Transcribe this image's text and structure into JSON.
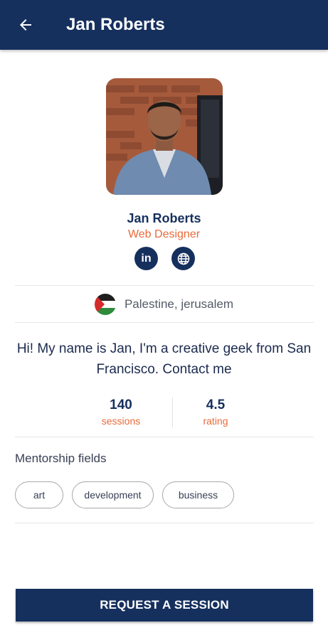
{
  "header": {
    "title": "Jan Roberts",
    "back_icon": "arrow-left-icon"
  },
  "profile": {
    "name": "Jan Roberts",
    "role": "Web Designer",
    "social": [
      {
        "icon": "linkedin-icon",
        "label": "in"
      },
      {
        "icon": "globe-icon"
      }
    ],
    "location": {
      "flag_icon": "palestine-flag-icon",
      "text": "Palestine, jerusalem"
    },
    "bio": "Hi! My name is Jan, I'm a creative geek from San Francisco. Contact me",
    "stats": [
      {
        "value": "140",
        "label": "sessions"
      },
      {
        "value": "4.5",
        "label": "rating"
      }
    ]
  },
  "mentorship": {
    "title": "Mentorship fields",
    "fields": [
      "art",
      "development",
      "business"
    ]
  },
  "cta": {
    "label": "REQUEST A SESSION"
  },
  "colors": {
    "primary": "#16305e",
    "accent": "#e96a3b",
    "divider": "#e6e6ea"
  }
}
